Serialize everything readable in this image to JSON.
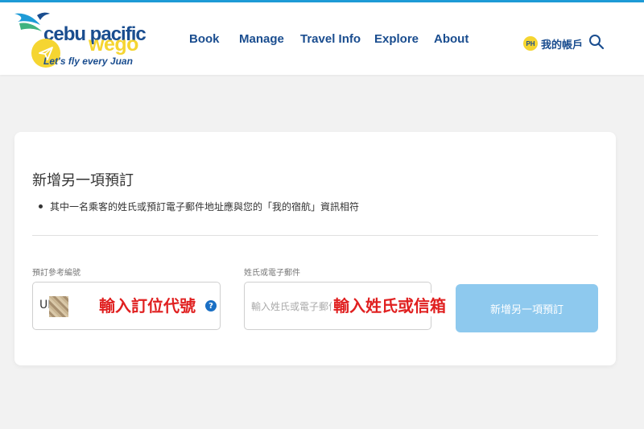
{
  "brand": {
    "name": "cebu pacific",
    "tagline": "Let's fly every Juan",
    "partner": "wego",
    "colors": {
      "primary": "#1a4d8f",
      "accent": "#f5d531",
      "stripe": "#1e9bd7",
      "button": "#8ec9ee",
      "highlight": "#e02020"
    }
  },
  "nav": {
    "items": [
      "Book",
      "Manage",
      "Travel Info",
      "Explore",
      "About"
    ]
  },
  "account": {
    "country_badge": "PH",
    "label": "我的帳戶",
    "search_icon": "search-icon"
  },
  "card": {
    "title": "新增另一項預訂",
    "note": "其中一名乘客的姓氏或預訂電子郵件地址應與您的「我的宿航」資訊相符",
    "booking_ref": {
      "label": "預訂參考編號",
      "value": "UI",
      "overlay": "輸入訂位代號",
      "help_icon": "?"
    },
    "name_email": {
      "label": "姓氏或電子郵件",
      "placeholder": "輸入姓氏或電子郵件",
      "overlay": "輸入姓氏或信箱"
    },
    "submit_label": "新增另一項預訂"
  }
}
